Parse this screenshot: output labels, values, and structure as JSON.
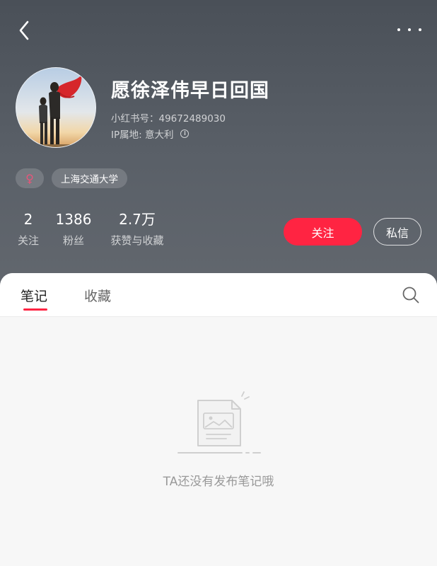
{
  "header": {
    "back_icon": "chevron-left-icon",
    "more_icon": "more-horizontal-icon"
  },
  "profile": {
    "name": "愿徐泽伟早日回国",
    "id_label": "小红书号：49672489030",
    "ip_label": "IP属地: 意大利",
    "ip_info_icon": "info-icon",
    "tags": {
      "gender_symbol": "♀",
      "school": "上海交通大学"
    },
    "gender_color": "#e9557a"
  },
  "stats": [
    {
      "value": "2",
      "label": "关注"
    },
    {
      "value": "1386",
      "label": "粉丝"
    },
    {
      "value": "2.7万",
      "label": "获赞与收藏"
    }
  ],
  "actions": {
    "follow_label": "关注",
    "message_label": "私信",
    "accent_color": "#ff2442"
  },
  "tabs": {
    "notes_label": "笔记",
    "collect_label": "收藏",
    "active_tab": "笔记",
    "search_icon": "search-icon"
  },
  "empty_state": {
    "icon": "empty-note-icon",
    "message": "TA还没有发布笔记哦"
  }
}
